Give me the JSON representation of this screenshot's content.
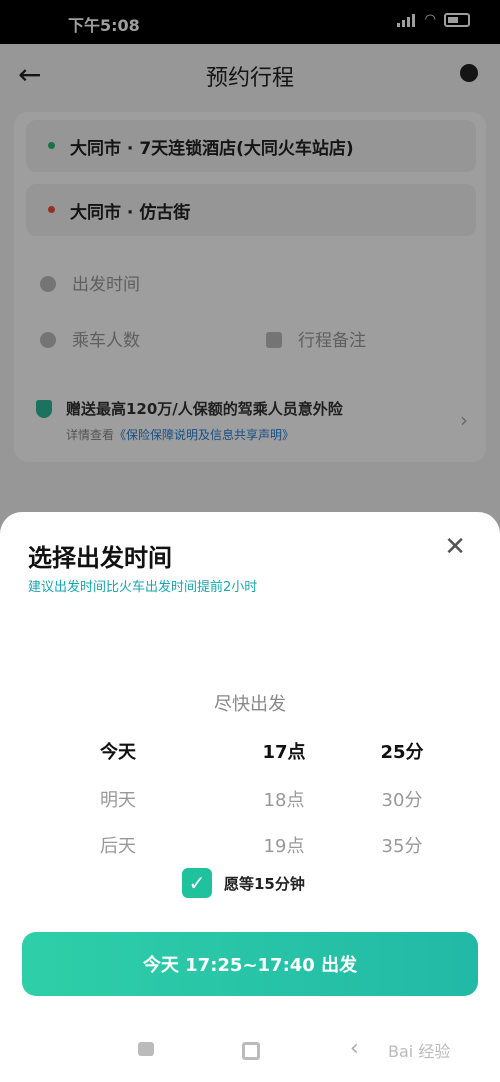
{
  "status_bar": {
    "time": "下午5:08",
    "battery": "67"
  },
  "header": {
    "title": "预约行程"
  },
  "trip": {
    "start": {
      "city": "大同市",
      "sep": "·",
      "place": "7天连锁酒店(大同火车站店)"
    },
    "end": {
      "city": "大同市",
      "sep": "·",
      "place": "仿古街"
    },
    "depart_placeholder": "出发时间",
    "passengers_placeholder": "乘车人数",
    "note_placeholder": "行程备注",
    "colors": {
      "start": "#2bb86d",
      "end": "#ef4f3f"
    }
  },
  "insurance": {
    "title": "赠送最高120万/人保额的驾乘人员意外险",
    "detail_prefix": "详情查看",
    "detail_link": "《保险保障说明及信息共享声明》"
  },
  "sheet": {
    "title": "选择出发时间",
    "subtitle": "建议出发时间比火车出发时间提前2小时",
    "picker": {
      "hint": "尽快出发",
      "days": [
        "今天",
        "明天",
        "后天"
      ],
      "hours": [
        "17点",
        "18点",
        "19点"
      ],
      "minutes": [
        "25分",
        "30分",
        "35分"
      ],
      "selected_index": 0
    },
    "wait_label": "愿等15分钟",
    "wait_checked": true,
    "confirm_label": "今天 17:25~17:40 出发"
  },
  "system_nav": {
    "watermark": "Bai 经验"
  },
  "colors": {
    "accent": "#20c29d",
    "link": "#1aa6b0"
  }
}
